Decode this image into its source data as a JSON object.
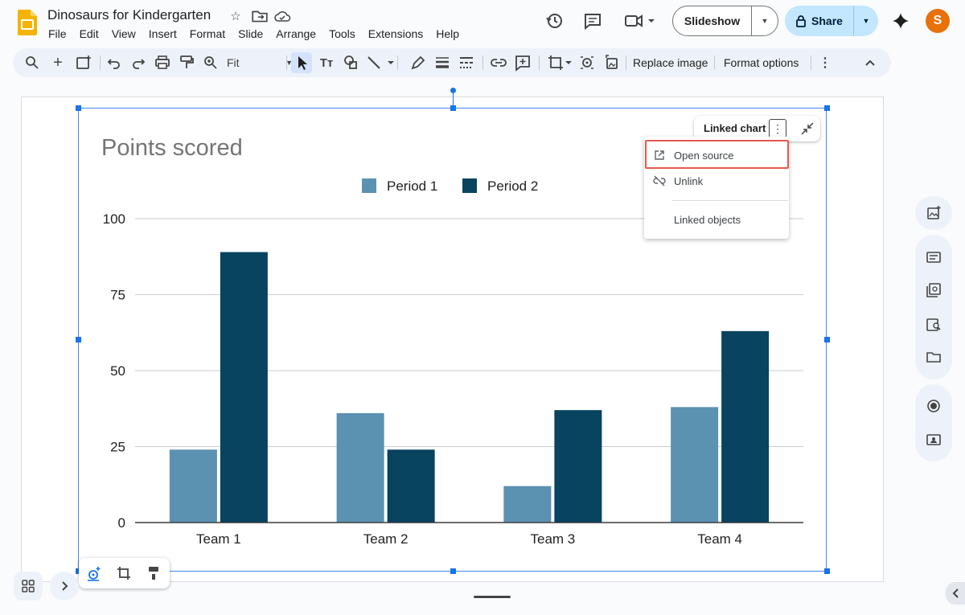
{
  "doc": {
    "title": "Dinosaurs for Kindergarten"
  },
  "menu": [
    "File",
    "Edit",
    "View",
    "Insert",
    "Format",
    "Slide",
    "Arrange",
    "Tools",
    "Extensions",
    "Help"
  ],
  "header": {
    "slideshow_label": "Slideshow",
    "share_label": "Share",
    "avatar_letter": "S"
  },
  "toolbar": {
    "zoom_value": "Fit",
    "replace_image": "Replace image",
    "format_options": "Format options"
  },
  "linked_chart": {
    "chip_label": "Linked chart",
    "menu_items": [
      "Open source",
      "Unlink",
      "Linked objects"
    ]
  },
  "colors": {
    "accent": "#1a73e8",
    "series1": "#5b91b1",
    "series2": "#08435f",
    "highlight": "#e35a50"
  },
  "chart_data": {
    "type": "bar",
    "title": "Points scored",
    "categories": [
      "Team 1",
      "Team 2",
      "Team 3",
      "Team 4"
    ],
    "series": [
      {
        "name": "Period 1",
        "values": [
          24,
          36,
          12,
          38
        ],
        "color": "#5b91b1"
      },
      {
        "name": "Period 2",
        "values": [
          89,
          24,
          37,
          63
        ],
        "color": "#08435f"
      }
    ],
    "ylim": [
      0,
      100
    ],
    "yticks": [
      0,
      25,
      50,
      75,
      100
    ],
    "grid": true,
    "legend_position": "top"
  }
}
